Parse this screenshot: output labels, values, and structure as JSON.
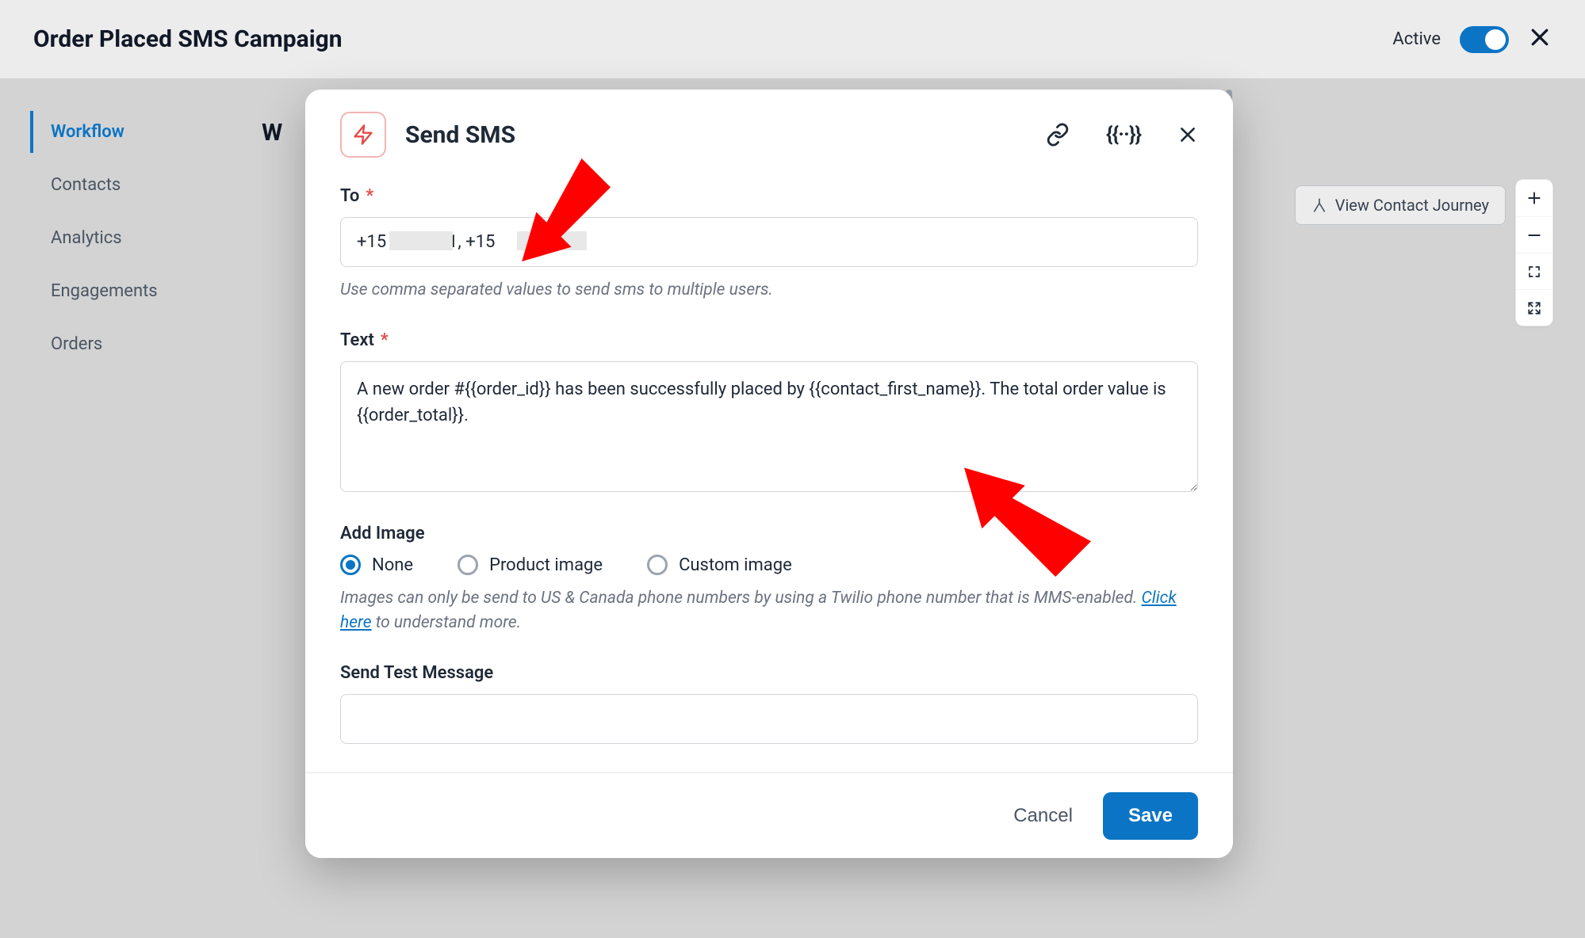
{
  "topbar": {
    "title": "Order Placed SMS Campaign",
    "active_label": "Active"
  },
  "sidebar": {
    "items": [
      {
        "label": "Workflow",
        "active": true
      },
      {
        "label": "Contacts"
      },
      {
        "label": "Analytics"
      },
      {
        "label": "Engagements"
      },
      {
        "label": "Orders"
      }
    ]
  },
  "background": {
    "partial_title": "W"
  },
  "right_controls": {
    "view_journey": "View Contact Journey"
  },
  "modal": {
    "title": "Send SMS",
    "to": {
      "label": "To",
      "value": "+15            21, +15             78",
      "helper": "Use comma separated values to send sms to multiple users."
    },
    "text": {
      "label": "Text",
      "value": "A new order #{{order_id}} has been successfully placed by {{contact_first_name}}. The total order value is {{order_total}}."
    },
    "add_image": {
      "label": "Add Image",
      "options": {
        "none": "None",
        "product": "Product image",
        "custom": "Custom image"
      },
      "helper_prefix": "Images can only be send to US & Canada phone numbers by using a Twilio phone number that is MMS-enabled. ",
      "helper_link": "Click here",
      "helper_suffix": " to understand more."
    },
    "send_test": {
      "label": "Send Test Message"
    },
    "footer": {
      "cancel": "Cancel",
      "save": "Save"
    }
  }
}
